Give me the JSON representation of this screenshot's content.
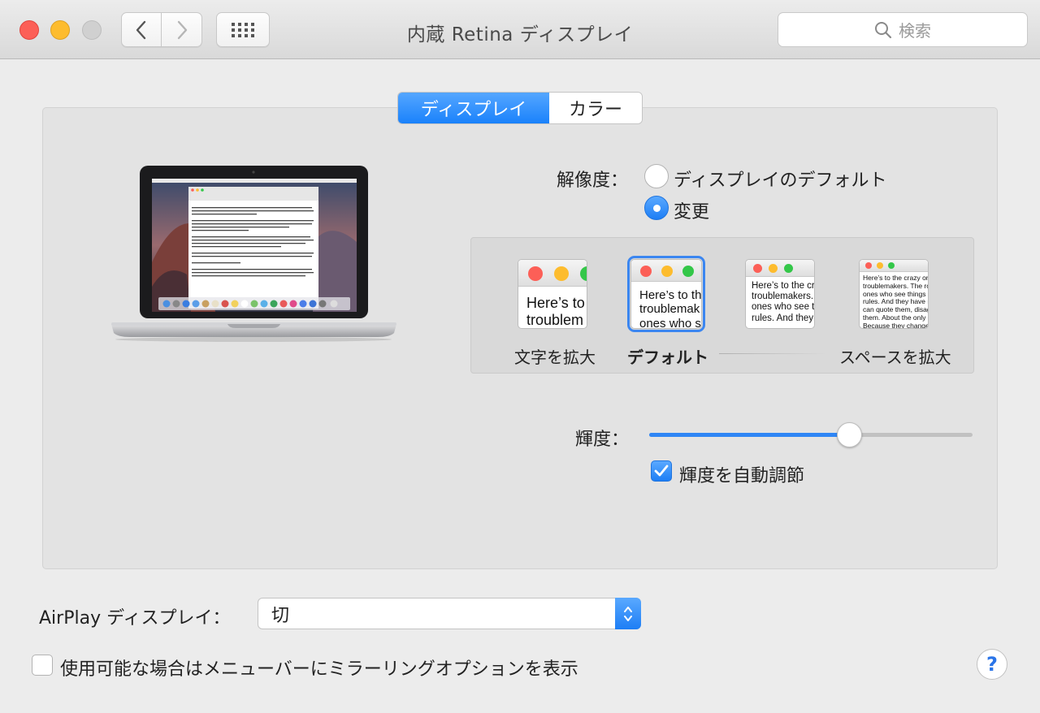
{
  "window": {
    "title": "内蔵 Retina ディスプレイ"
  },
  "toolbar": {
    "search_placeholder": "検索"
  },
  "tabs": [
    {
      "label": "ディスプレイ"
    },
    {
      "label": "カラー"
    }
  ],
  "resolution": {
    "label": "解像度：",
    "options": [
      {
        "label": "ディスプレイのデフォルト",
        "selected": false
      },
      {
        "label": "変更",
        "selected": true
      }
    ],
    "scale_labels": {
      "larger_text": "文字を拡大",
      "default": "デフォルト",
      "more_space": "スペースを拡大"
    },
    "previews": [
      "Here’s to\ntroublem",
      "Here’s to th\ntroublemak\nones who s",
      "Here’s to the cr\ntroublemakers.\nones who see t\nrules. And they",
      "Here’s to the crazy one\ntroublemakers. The rou\nones who see things di\nrules. And they have no\ncan quote them, disagre\nthem. About the only th\nBecause they change th"
    ]
  },
  "brightness": {
    "label": "輝度：",
    "level": 0.62,
    "auto_label": "輝度を自動調節",
    "auto": true
  },
  "airplay": {
    "label": "AirPlay ディスプレイ：",
    "value": "切"
  },
  "mirroring": {
    "label": "使用可能な場合はメニューバーにミラーリングオプションを表示",
    "checked": false
  },
  "help": {
    "label": "?"
  },
  "colors": {
    "accent": "#1a82fb",
    "close": "#fc5f57",
    "minimize": "#fdbc2e",
    "zoom": "#34c749"
  }
}
